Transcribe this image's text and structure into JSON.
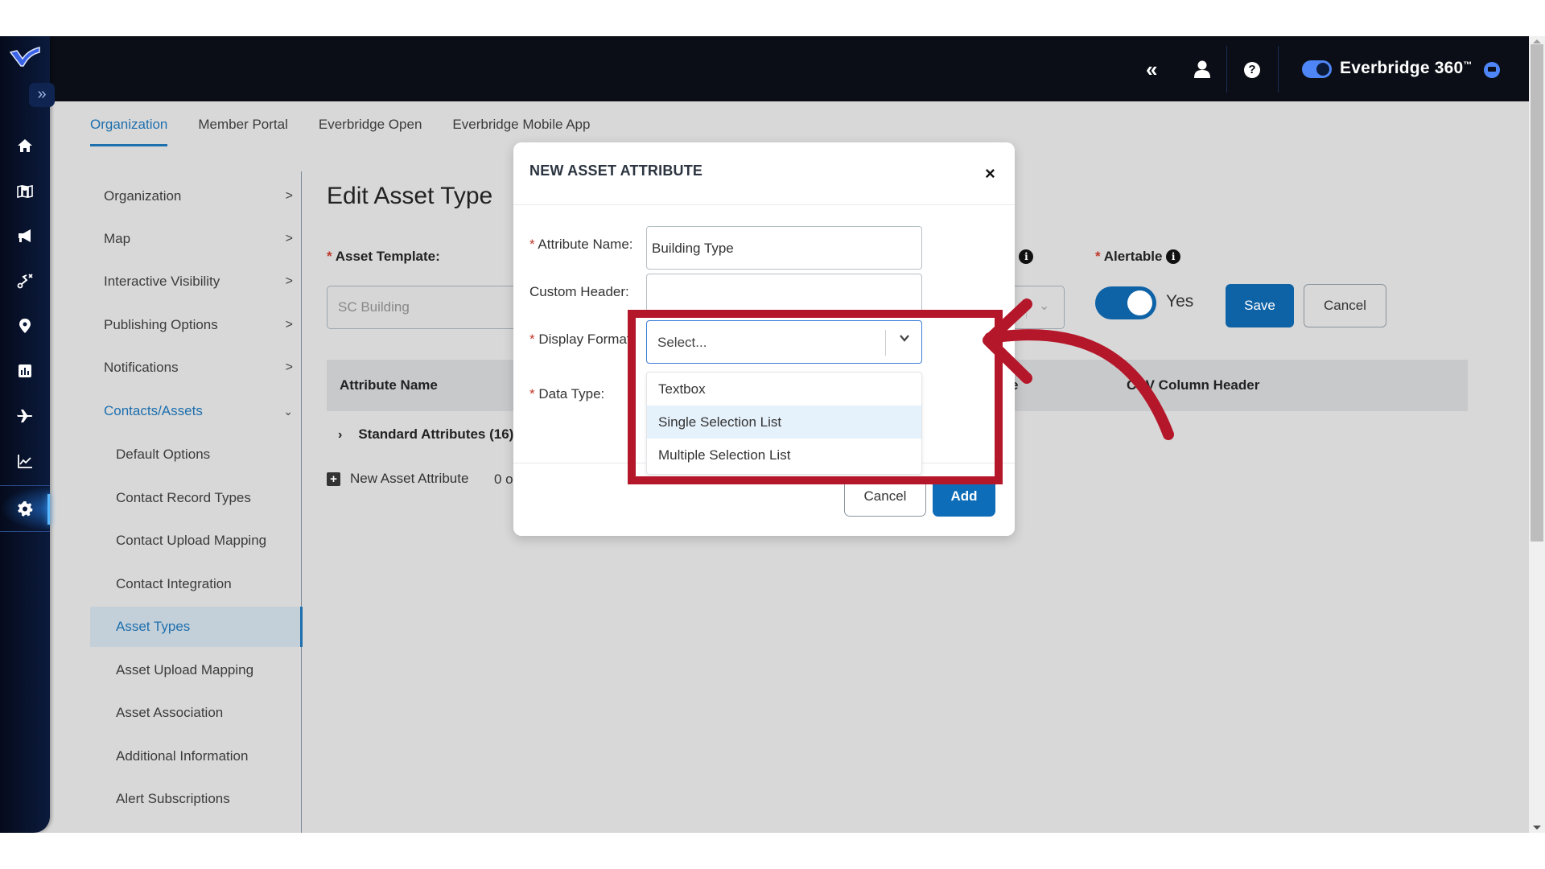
{
  "header": {
    "brand_label": "Everbridge 360",
    "brand_mark": "™",
    "icons": [
      "collapse-double-left-icon",
      "user-icon",
      "help-icon",
      "toggle-360",
      "chat-icon"
    ]
  },
  "rail": {
    "expand_label": "»",
    "items": [
      {
        "name": "home",
        "icon": "home-icon"
      },
      {
        "name": "map",
        "icon": "map-icon"
      },
      {
        "name": "notifications",
        "icon": "megaphone-icon"
      },
      {
        "name": "incidents",
        "icon": "route-icon"
      },
      {
        "name": "locations",
        "icon": "location-pin-icon"
      },
      {
        "name": "reports",
        "icon": "report-icon"
      },
      {
        "name": "travel",
        "icon": "airplane-icon"
      },
      {
        "name": "analytics",
        "icon": "chart-line-icon"
      },
      {
        "name": "settings",
        "icon": "gear-icon",
        "active": true
      }
    ]
  },
  "tabs": [
    {
      "label": "Organization",
      "active": true
    },
    {
      "label": "Member Portal"
    },
    {
      "label": "Everbridge Open"
    },
    {
      "label": "Everbridge Mobile App"
    }
  ],
  "leftnav": {
    "sections": [
      {
        "label": "Organization",
        "chevron": ">"
      },
      {
        "label": "Map",
        "chevron": ">"
      },
      {
        "label": "Interactive Visibility",
        "chevron": ">"
      },
      {
        "label": "Publishing Options",
        "chevron": ">"
      },
      {
        "label": "Notifications",
        "chevron": ">"
      },
      {
        "label": "Contacts/Assets",
        "chevron": "v",
        "expanded": true
      }
    ],
    "sub_items": [
      {
        "label": "Default Options"
      },
      {
        "label": "Contact Record Types"
      },
      {
        "label": "Contact Upload Mapping"
      },
      {
        "label": "Contact Integration"
      },
      {
        "label": "Asset Types",
        "active": true
      },
      {
        "label": "Asset Upload Mapping"
      },
      {
        "label": "Asset Association"
      },
      {
        "label": "Additional Information"
      },
      {
        "label": "Alert Subscriptions"
      }
    ]
  },
  "page": {
    "title": "Edit Asset Type",
    "asset_template_label": "Asset Template:",
    "asset_template_value": "SC Building",
    "hidden_field_label_tail": ":",
    "alertable_label": "Alertable",
    "alertable_value": "Yes",
    "alertable_on": true,
    "save_label": "Save",
    "cancel_label": "Cancel",
    "table_headers": [
      "Attribute Name",
      "CSV Column Header"
    ],
    "partial_header": "e",
    "group_row": "Standard Attributes (16)",
    "new_attribute_label": "New Asset Attribute",
    "count_text": "0 o"
  },
  "modal": {
    "title": "NEW ASSET ATTRIBUTE",
    "close_label": "×",
    "attribute_name_label": "Attribute Name:",
    "attribute_name_value": "Building Type",
    "custom_header_label": "Custom Header:",
    "custom_header_value": "",
    "display_format_label": "Display Format:",
    "display_format_placeholder": "Select...",
    "data_type_label": "Data Type:",
    "display_format_options": [
      {
        "label": "Textbox"
      },
      {
        "label": "Single Selection List",
        "hover": true
      },
      {
        "label": "Multiple Selection List"
      }
    ],
    "cancel_label": "Cancel",
    "add_label": "Add"
  },
  "annotation": {
    "color": "#b5172a",
    "type": "highlight-box-with-curved-arrow"
  },
  "colors": {
    "accent": "#1d6fae",
    "primary_button": "#0e62a6",
    "header_bg": "#0b0e16",
    "rail_bg": "#0b1a3c",
    "annotation_red": "#b5172a"
  }
}
